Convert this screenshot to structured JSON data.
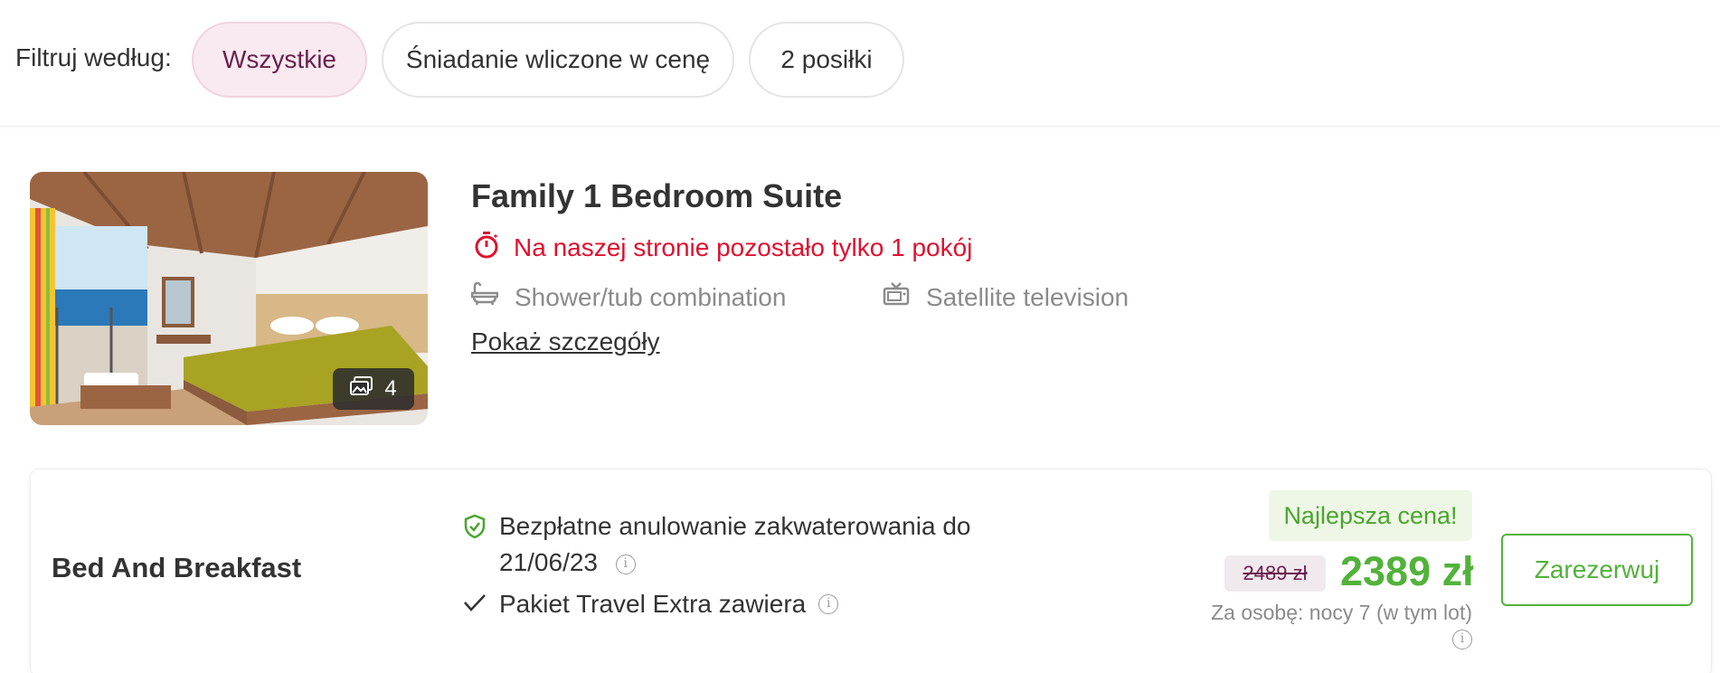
{
  "filters": {
    "label": "Filtruj według:",
    "chips": [
      {
        "label": "Wszystkie",
        "active": true
      },
      {
        "label": "Śniadanie wliczone w cenę",
        "active": false
      },
      {
        "label": "2 posiłki",
        "active": false
      }
    ]
  },
  "room": {
    "title": "Family 1 Bedroom Suite",
    "photo_count": "4",
    "urgency": "Na naszej stronie pozostało tylko 1 pokój",
    "amenities": [
      {
        "icon": "bathtub-icon",
        "label": "Shower/tub combination"
      },
      {
        "icon": "tv-icon",
        "label": "Satellite television"
      }
    ],
    "details_link": "Pokaż szczegóły"
  },
  "offer": {
    "board": "Bed And Breakfast",
    "cancellation": "Bezpłatne anulowanie zakwaterowania do 21/06/23",
    "package": "Pakiet Travel Extra zawiera",
    "best_price_badge": "Najlepsza cena!",
    "old_price": "2489 zł",
    "price": "2389 zł",
    "price_note": "Za osobę: nocy 7 (w tym lot)",
    "book_button": "Zarezerwuj"
  },
  "colors": {
    "accent_purple": "#6b1f4e",
    "urgency_red": "#e0102f",
    "price_green": "#52b23a"
  }
}
